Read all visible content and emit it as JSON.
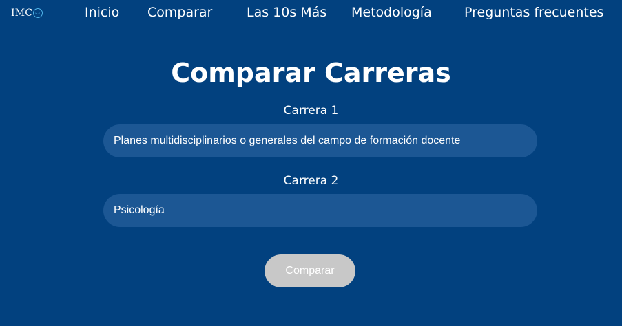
{
  "brand": {
    "logo_text": "IMC",
    "logo_icon": "imco-globe-icon"
  },
  "nav": {
    "items": [
      {
        "label": "Inicio"
      },
      {
        "label": "Comparar"
      },
      {
        "label": "Las 10s Más"
      },
      {
        "label": "Metodología"
      },
      {
        "label": "Preguntas frecuentes"
      }
    ]
  },
  "main": {
    "title": "Comparar Carreras",
    "career1": {
      "label": "Carrera 1",
      "value": "Planes multidisciplinarios o generales del campo de formación docente"
    },
    "career2": {
      "label": "Carrera 2",
      "value": "Psicología"
    },
    "compare_button_label": "Comparar"
  },
  "colors": {
    "background": "#02417f",
    "input_background": "#1c5794",
    "button_background": "#c8c8c8",
    "logo_accent": "#4fb3e8"
  }
}
